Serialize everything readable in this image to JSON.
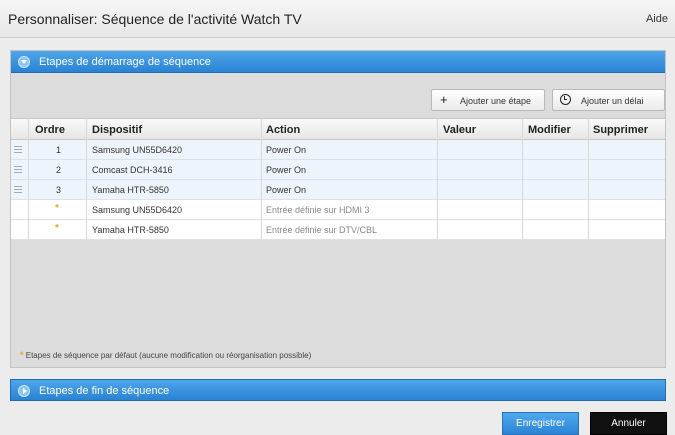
{
  "window": {
    "title": "Personnaliser: Séquence de l'activité Watch TV",
    "help": "Aide"
  },
  "start_section": {
    "label": "Etapes de démarrage de séquence",
    "add_step": "Ajouter une étape",
    "add_delay": "Ajouter un délai",
    "columns": [
      "Ordre",
      "Dispositif",
      "Action",
      "Valeur",
      "Modifier",
      "Supprimer"
    ],
    "rows": [
      {
        "order": "1",
        "device": "Samsung UN55D6420",
        "action": "Power On"
      },
      {
        "order": "2",
        "device": "Comcast DCH-3416",
        "action": "Power On"
      },
      {
        "order": "3",
        "device": "Yamaha HTR-5850",
        "action": "Power On"
      }
    ],
    "default_rows": [
      {
        "order": "*",
        "device": "Samsung UN55D6420",
        "action": "Entrée définie sur HDMI 3"
      },
      {
        "order": "*",
        "device": "Yamaha HTR-5850",
        "action": "Entrée définie sur DTV/CBL"
      }
    ],
    "footnote_marker": "*",
    "footnote": "Etapes de séquence par défaut (aucune modification ou réorganisation possible)"
  },
  "end_section": {
    "label": "Etapes de fin de séquence"
  },
  "actions": {
    "save": "Enregistrer",
    "cancel": "Annuler"
  },
  "colors": {
    "accent": "#2a82d4",
    "star": "#f2a31b",
    "cancel_bg": "#111111"
  }
}
